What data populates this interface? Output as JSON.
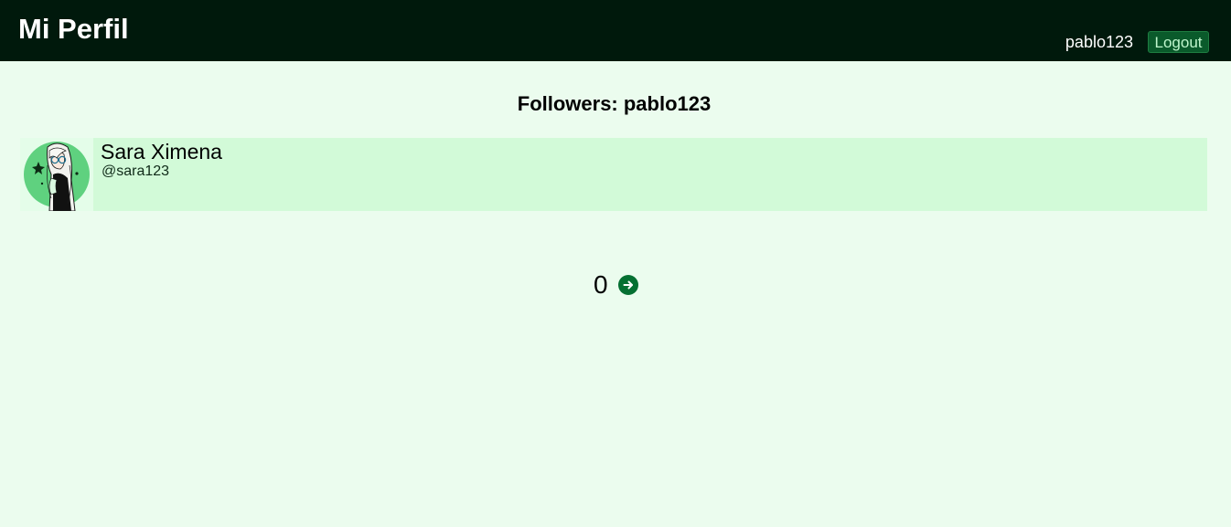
{
  "header": {
    "title": "Mi Perfil",
    "username": "pablo123",
    "logout_label": "Logout"
  },
  "main": {
    "heading": "Followers: pablo123",
    "followers": [
      {
        "name": "Sara Ximena",
        "handle": "@sara123",
        "avatar_icon": "avatar-illustration"
      }
    ],
    "pagination": {
      "current_page": "0",
      "next_icon": "arrow-right-circle-icon"
    }
  },
  "colors": {
    "header_bg": "#00190c",
    "page_bg": "#ebfcee",
    "row_bg": "#d2fad8",
    "accent": "#057032",
    "logout_bg": "#0a5a2b"
  }
}
